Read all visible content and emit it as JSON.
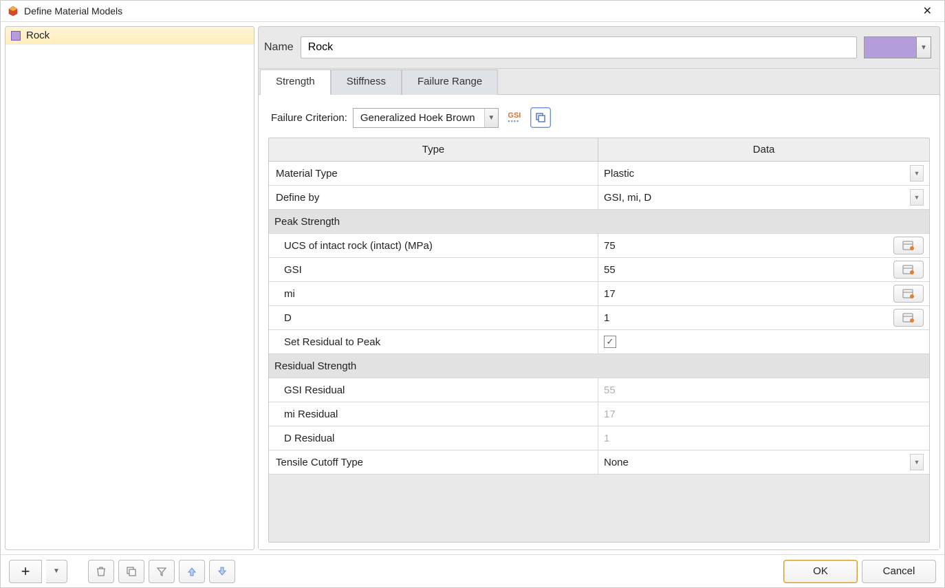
{
  "window": {
    "title": "Define Material Models"
  },
  "sidebar": {
    "items": [
      {
        "name": "Rock",
        "color": "#b39ddb"
      }
    ]
  },
  "name": {
    "label": "Name",
    "value": "Rock",
    "color": "#b39ddb"
  },
  "tabs": {
    "strength": "Strength",
    "stiffness": "Stiffness",
    "failure_range": "Failure Range"
  },
  "criterion": {
    "label": "Failure Criterion:",
    "value": "Generalized Hoek Brown"
  },
  "table": {
    "head_type": "Type",
    "head_data": "Data",
    "material_type": {
      "label": "Material Type",
      "value": "Plastic"
    },
    "define_by": {
      "label": "Define by",
      "value": "GSI, mi, D"
    },
    "peak_header": "Peak Strength",
    "ucs": {
      "label": "UCS of intact rock (intact) (MPa)",
      "value": "75"
    },
    "gsi": {
      "label": "GSI",
      "value": "55"
    },
    "mi": {
      "label": "mi",
      "value": "17"
    },
    "d": {
      "label": "D",
      "value": "1"
    },
    "set_residual": {
      "label": "Set Residual to Peak",
      "checked": true
    },
    "residual_header": "Residual Strength",
    "gsi_res": {
      "label": "GSI Residual",
      "value": "55"
    },
    "mi_res": {
      "label": "mi Residual",
      "value": "17"
    },
    "d_res": {
      "label": "D Residual",
      "value": "1"
    },
    "tensile": {
      "label": "Tensile Cutoff Type",
      "value": "None"
    }
  },
  "footer": {
    "ok": "OK",
    "cancel": "Cancel"
  }
}
